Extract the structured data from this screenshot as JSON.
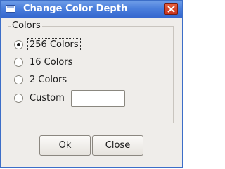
{
  "window": {
    "title": "Change Color Depth"
  },
  "group": {
    "label": "Colors",
    "options": [
      {
        "label": "256 Colors",
        "checked": true
      },
      {
        "label": "16 Colors",
        "checked": false
      },
      {
        "label": "2 Colors",
        "checked": false
      },
      {
        "label": "Custom",
        "checked": false
      }
    ],
    "custom_value": ""
  },
  "buttons": {
    "ok": "Ok",
    "close": "Close"
  }
}
